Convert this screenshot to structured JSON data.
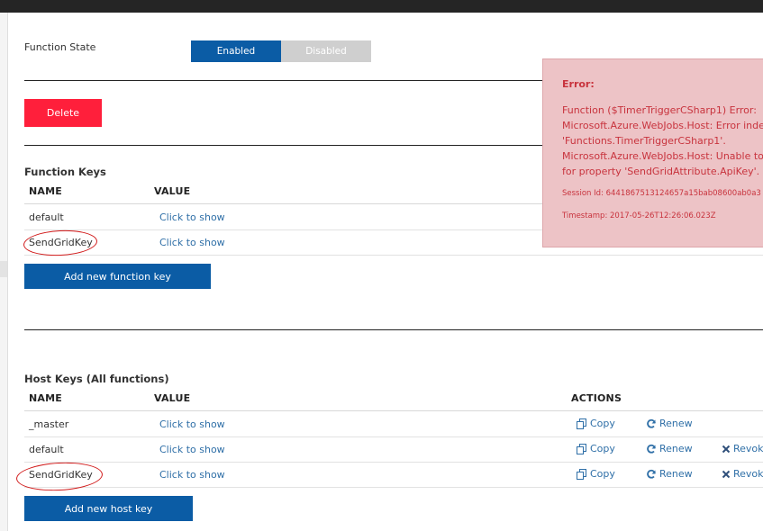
{
  "function_state": {
    "label": "Function State",
    "enabled_label": "Enabled",
    "disabled_label": "Disabled",
    "selected": "Enabled"
  },
  "delete_button": "Delete",
  "function_keys": {
    "title": "Function Keys",
    "columns": {
      "name": "NAME",
      "value": "VALUE"
    },
    "rows": [
      {
        "name": "default",
        "value": "Click to show"
      },
      {
        "name": "SendGridKey",
        "value": "Click to show"
      }
    ],
    "add_button": "Add new function key"
  },
  "host_keys": {
    "title": "Host Keys (All functions)",
    "columns": {
      "name": "NAME",
      "value": "VALUE",
      "actions": "ACTIONS"
    },
    "rows": [
      {
        "name": "_master",
        "value": "Click to show",
        "copy": "Copy",
        "renew": "Renew",
        "revoke": ""
      },
      {
        "name": "default",
        "value": "Click to show",
        "copy": "Copy",
        "renew": "Renew",
        "revoke": "Revok"
      },
      {
        "name": "SendGridKey",
        "value": "Click to show",
        "copy": "Copy",
        "renew": "Renew",
        "revoke": "Revok"
      }
    ],
    "add_button": "Add new host key"
  },
  "error": {
    "title": "Error:",
    "message_lines": [
      "Function ($TimerTriggerCSharp1) Error:",
      "Microsoft.Azure.WebJobs.Host: Error indexi",
      "'Functions.TimerTriggerCSharp1'.",
      "Microsoft.Azure.WebJobs.Host: Unable to r",
      "for property 'SendGridAttribute.ApiKey'."
    ],
    "session": "Session Id: 6441867513124657a15bab08600ab0a3",
    "timestamp": "Timestamp: 2017-05-26T12:26:06.023Z"
  },
  "colors": {
    "primary": "#0b5ca5",
    "danger": "#ff1f3b",
    "error_bg": "#edc3c6",
    "error_text": "#c8333d",
    "link": "#2f6fa7",
    "annotation": "#d11a1a"
  },
  "icons": {
    "copy": "copy-icon",
    "renew": "refresh-icon",
    "revoke": "close-icon"
  }
}
